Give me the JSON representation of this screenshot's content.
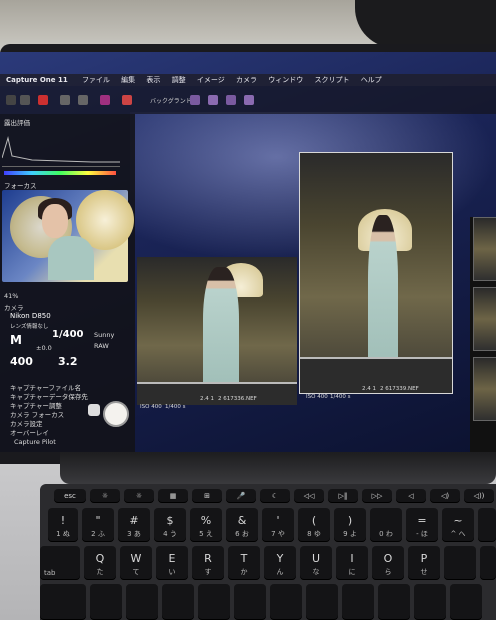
{
  "scene": {
    "description_colors": {
      "screen_bg": "#1a2457",
      "keyboard": "#141416",
      "deck": "#c4c4c6"
    }
  },
  "app": {
    "title": "Capture One 11",
    "menu": [
      "ファイル",
      "編集",
      "表示",
      "調整",
      "イメージ",
      "カメラ",
      "ウィンドウ",
      "スクリプト",
      "ヘルプ"
    ],
    "toolbar_label": "バックグランド"
  },
  "sidebar": {
    "histogram_label": "露出評価",
    "focus_label": "フォーカス",
    "zoom": "41%",
    "camera_section": "カメラ",
    "camera_model": "Nikon D850",
    "camera_sub": "レンズ情報なし",
    "mode": "M",
    "shutter": "1/400",
    "ev": "±0.0",
    "iso": "400",
    "aperture": "3.2",
    "wb": "Sunny",
    "format": "RAW",
    "tools": [
      "キャプチャーファイル名",
      "キャプチャーデータ保存先",
      "キャプチャー調整",
      "カメラ フォーカス",
      "カメラ設定",
      "オーバーレイ"
    ],
    "footer": "Capture Pilot"
  },
  "viewer": {
    "left_caption": {
      "iso": "ISO 400",
      "shutter": "1/400 s",
      "ap": "2.4 1",
      "file": "2 617336.NEF"
    },
    "right_caption": {
      "iso": "ISO 400",
      "shutter": "1/400 s",
      "ap": "2.4 1",
      "file": "2 617339.NEF"
    }
  },
  "keyboard": {
    "fn_row": [
      "esc",
      "☼",
      "☼",
      "▦",
      "⊞",
      "🎤",
      "☾",
      "◁◁",
      "▷‖",
      "▷▷",
      "◁",
      "◁)",
      "◁))"
    ],
    "num_row": [
      {
        "main": "!",
        "sub": "1 ぬ"
      },
      {
        "main": "\"",
        "sub": "2 ふ"
      },
      {
        "main": "#",
        "sub": "3 あ"
      },
      {
        "main": "$",
        "sub": "4 う"
      },
      {
        "main": "%",
        "sub": "5 え"
      },
      {
        "main": "&",
        "sub": "6 お"
      },
      {
        "main": "'",
        "sub": "7 や"
      },
      {
        "main": "(",
        "sub": "8 ゆ"
      },
      {
        "main": ")",
        "sub": "9 よ"
      },
      {
        "main": "",
        "sub": "0 わ"
      },
      {
        "main": "=",
        "sub": "- ほ"
      },
      {
        "main": "~",
        "sub": "^ へ"
      }
    ],
    "q_row": [
      {
        "main": "tab",
        "sub": ""
      },
      {
        "main": "Q",
        "sub": "た"
      },
      {
        "main": "W",
        "sub": "て"
      },
      {
        "main": "E",
        "sub": "い"
      },
      {
        "main": "R",
        "sub": "す"
      },
      {
        "main": "T",
        "sub": "か"
      },
      {
        "main": "Y",
        "sub": "ん"
      },
      {
        "main": "U",
        "sub": "な"
      },
      {
        "main": "I",
        "sub": "に"
      },
      {
        "main": "O",
        "sub": "ら"
      },
      {
        "main": "P",
        "sub": "せ"
      }
    ]
  }
}
